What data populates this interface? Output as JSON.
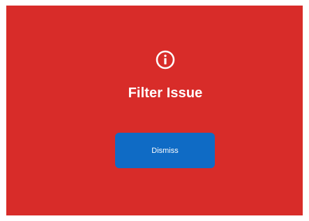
{
  "dialog": {
    "icon": "info-icon",
    "title": "Filter Issue",
    "dismiss_label": "Dismiss"
  },
  "colors": {
    "background": "#d82c29",
    "button": "#0f6bc5",
    "text": "#ffffff"
  }
}
